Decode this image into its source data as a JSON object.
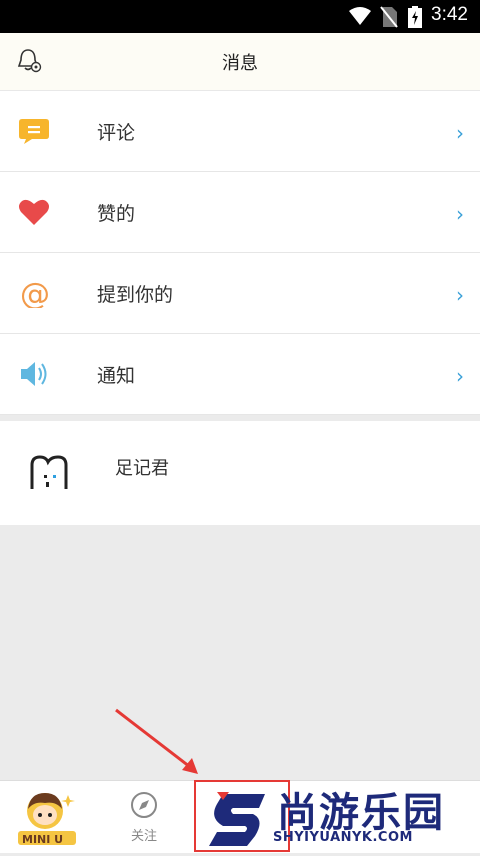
{
  "status_bar": {
    "time": "3:42"
  },
  "header": {
    "title": "消息"
  },
  "menu": [
    {
      "label": "评论",
      "icon": "comment-icon"
    },
    {
      "label": "赞的",
      "icon": "heart-icon"
    },
    {
      "label": "提到你的",
      "icon": "at-icon"
    },
    {
      "label": "通知",
      "icon": "speaker-icon"
    }
  ],
  "system_account": {
    "name": "足记君"
  },
  "tabbar": {
    "mini_label": "MINI U",
    "follow_label": "关注"
  },
  "watermark": {
    "title": "尚游乐园",
    "url": "SHYIYUANYK.COM"
  },
  "colors": {
    "comment": "#f7b52c",
    "heart": "#e84a4a",
    "at": "#f29a4a",
    "speaker": "#5fb7e0",
    "chevron": "#3aa0d8",
    "annotation": "#e53935",
    "watermark": "#1e2a7a"
  }
}
